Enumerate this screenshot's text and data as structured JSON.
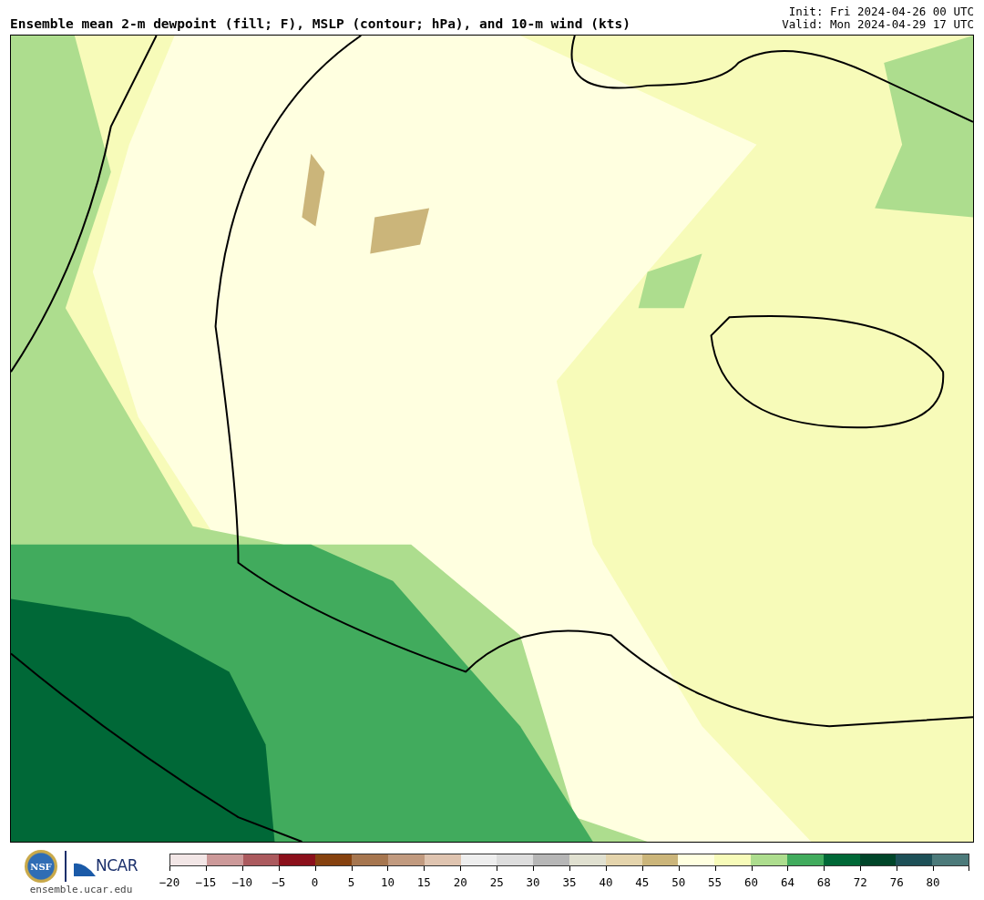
{
  "header": {
    "title": "Ensemble mean 2-m dewpoint (fill; F), MSLP (contour; hPa), and 10-m wind (kts)",
    "init": "Init: Fri 2024-04-26 00 UTC",
    "valid": "Valid: Mon 2024-04-29 17 UTC"
  },
  "footer": {
    "nsf_text": "NSF",
    "ncar_text": "NCAR",
    "url": "ensemble.ucar.edu"
  },
  "colorbar": {
    "segments": [
      {
        "color": "#f2e6e6"
      },
      {
        "color": "#cc9999"
      },
      {
        "color": "#ab5a5e"
      },
      {
        "color": "#8b101b"
      },
      {
        "color": "#86420f"
      },
      {
        "color": "#a6764f"
      },
      {
        "color": "#c19a7f"
      },
      {
        "color": "#dfc4b0"
      },
      {
        "color": "#eeeeee"
      },
      {
        "color": "#dddddd"
      },
      {
        "color": "#b6b6b6"
      },
      {
        "color": "#e0e0d0"
      },
      {
        "color": "#e4d4ac"
      },
      {
        "color": "#cbb57a"
      },
      {
        "color": "#ffffe0"
      },
      {
        "color": "#f7fbb9"
      },
      {
        "color": "#addd8e"
      },
      {
        "color": "#41ab5d"
      },
      {
        "color": "#006837"
      },
      {
        "color": "#004529"
      },
      {
        "color": "#1d5057"
      },
      {
        "color": "#4c7a7a"
      }
    ],
    "ticks": [
      "−20",
      "−15",
      "−10",
      "−5",
      "0",
      "5",
      "10",
      "15",
      "20",
      "25",
      "30",
      "35",
      "40",
      "45",
      "50",
      "55",
      "60",
      "64",
      "68",
      "72",
      "76",
      "80"
    ]
  }
}
